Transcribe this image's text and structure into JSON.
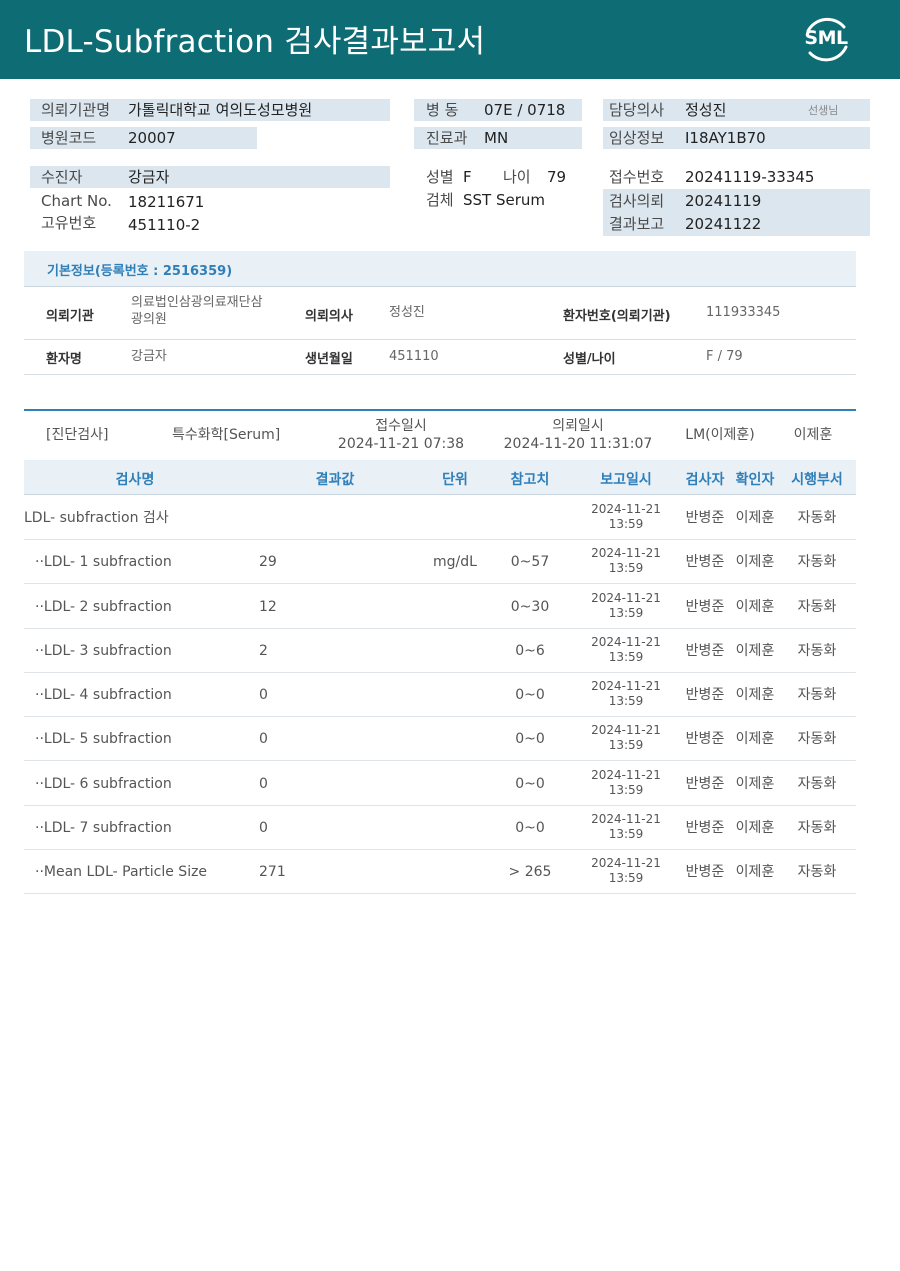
{
  "header": {
    "title": "LDL-Subfraction 검사결과보고서",
    "logo_text": "SML",
    "background": "#0d6c74"
  },
  "info": {
    "institution_label": "의뢰기관명",
    "institution_value": "가톨릭대학교 여의도성모병원",
    "hospital_code_label": "병원코드",
    "hospital_code_value": "20007",
    "ward_label": "병 동",
    "ward_value": "07E / 0718",
    "dept_label": "진료과",
    "dept_value": "MN",
    "doctor_label": "담당의사",
    "doctor_value": "정성진",
    "doctor_suffix": "선생님",
    "clinical_label": "임상정보",
    "clinical_value": "I18AY1B70",
    "patient_label": "수진자",
    "patient_value": "강금자",
    "chart_label": "Chart No.",
    "chart_value": "18211671",
    "unique_label": "고유번호",
    "unique_value": "451110-2",
    "sex_label": "성별",
    "sex_value": "F",
    "age_label": "나이",
    "age_value": "79",
    "specimen_label": "검체",
    "specimen_value": "SST Serum",
    "receipt_no_label": "접수번호",
    "receipt_no_value": "20241119-33345",
    "request_label": "검사의뢰",
    "request_value": "20241119",
    "report_label": "결과보고",
    "report_value": "20241122"
  },
  "basic": {
    "section_title": "기본정보(등록번호 : 2516359)",
    "rows": [
      {
        "k1": "의뢰기관",
        "v1": "의료법인삼광의료재단삼\n광의원",
        "k2": "의뢰의사",
        "v2": "정성진",
        "k3": "환자번호(의뢰기관)",
        "v3": "111933345"
      },
      {
        "k1": "환자명",
        "v1": "강금자",
        "k2": "생년월일",
        "v2": "451110",
        "k3": "성별/나이",
        "v3": "F / 79"
      }
    ]
  },
  "result_meta": {
    "category": "[진단검사]",
    "subcategory": "특수화학[Serum]",
    "received_label": "접수일시",
    "received_value": "2024-11-21 07:38",
    "requested_label": "의뢰일시",
    "requested_value": "2024-11-20 11:31:07",
    "lm": "LM(이제훈)",
    "confirmer": "이제훈"
  },
  "table": {
    "headers": [
      "검사명",
      "결과값",
      "단위",
      "참고치",
      "보고일시",
      "검사자",
      "확인자",
      "시행부서"
    ],
    "rows": [
      {
        "name": "LDL- subfraction 검사",
        "result": "",
        "unit": "",
        "ref": "",
        "date": "2024-11-21",
        "time": "13:59",
        "tester": "반병준",
        "confirmer": "이제훈",
        "dept": "자동화"
      },
      {
        "name": "··LDL- 1 subfraction",
        "result": "29",
        "unit": "mg/dL",
        "ref": "0~57",
        "date": "2024-11-21",
        "time": "13:59",
        "tester": "반병준",
        "confirmer": "이제훈",
        "dept": "자동화"
      },
      {
        "name": "··LDL- 2 subfraction",
        "result": "12",
        "unit": "",
        "ref": "0~30",
        "date": "2024-11-21",
        "time": "13:59",
        "tester": "반병준",
        "confirmer": "이제훈",
        "dept": "자동화"
      },
      {
        "name": "··LDL- 3 subfraction",
        "result": "2",
        "unit": "",
        "ref": "0~6",
        "date": "2024-11-21",
        "time": "13:59",
        "tester": "반병준",
        "confirmer": "이제훈",
        "dept": "자동화"
      },
      {
        "name": "··LDL- 4 subfraction",
        "result": "0",
        "unit": "",
        "ref": "0~0",
        "date": "2024-11-21",
        "time": "13:59",
        "tester": "반병준",
        "confirmer": "이제훈",
        "dept": "자동화"
      },
      {
        "name": "··LDL- 5 subfraction",
        "result": "0",
        "unit": "",
        "ref": "0~0",
        "date": "2024-11-21",
        "time": "13:59",
        "tester": "반병준",
        "confirmer": "이제훈",
        "dept": "자동화"
      },
      {
        "name": "··LDL- 6 subfraction",
        "result": "0",
        "unit": "",
        "ref": "0~0",
        "date": "2024-11-21",
        "time": "13:59",
        "tester": "반병준",
        "confirmer": "이제훈",
        "dept": "자동화"
      },
      {
        "name": "··LDL- 7 subfraction",
        "result": "0",
        "unit": "",
        "ref": "0~0",
        "date": "2024-11-21",
        "time": "13:59",
        "tester": "반병준",
        "confirmer": "이제훈",
        "dept": "자동화"
      },
      {
        "name": "··Mean LDL- Particle Size",
        "result": "271",
        "unit": "",
        "ref": "> 265",
        "date": "2024-11-21",
        "time": "13:59",
        "tester": "반병준",
        "confirmer": "이제훈",
        "dept": "자동화"
      }
    ]
  }
}
